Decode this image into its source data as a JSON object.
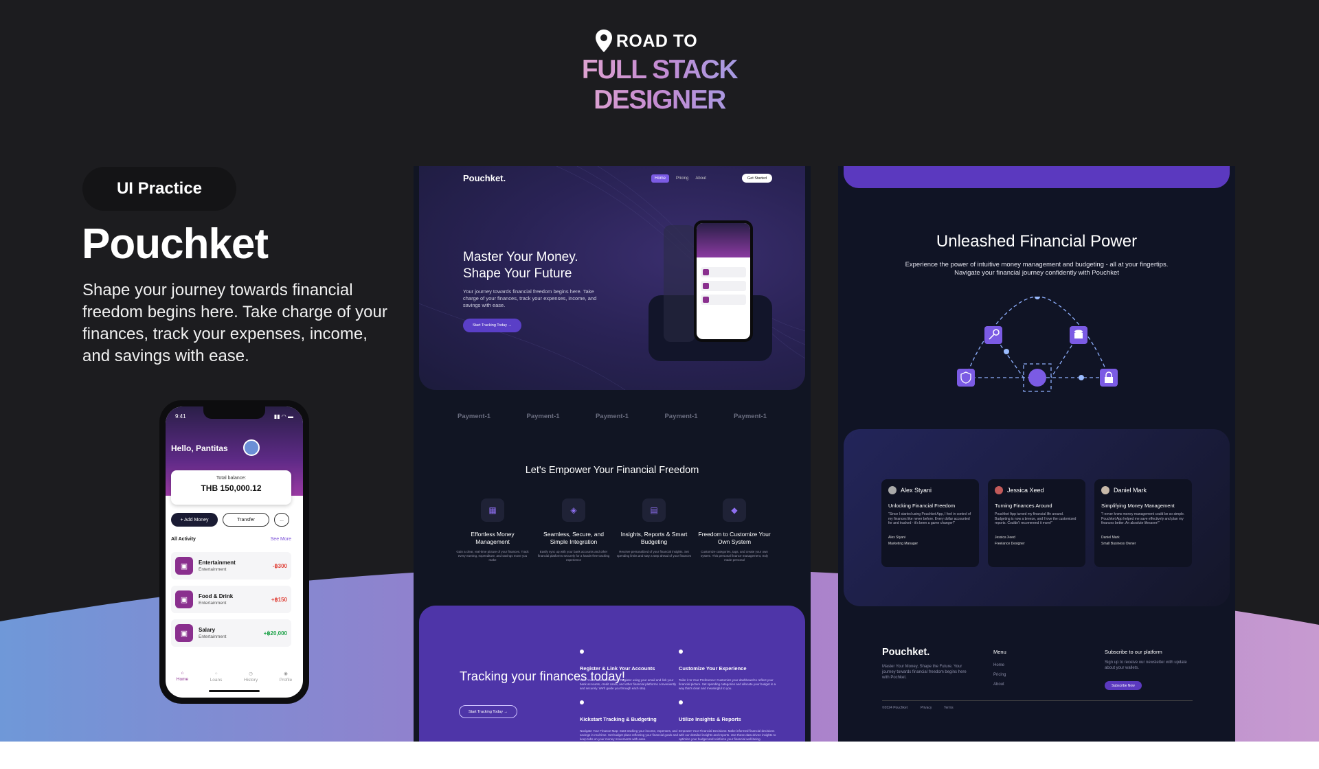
{
  "header": {
    "road_to": "ROAD TO",
    "title": "FULL STACK DESIGNER",
    "pin_icon": "location-pin-icon"
  },
  "left": {
    "pill": "UI Practice",
    "title": "Pouchket",
    "description": "Shape your  journey towards financial freedom begins here. Take charge of your finances, track your expenses, income, and savings with ease."
  },
  "phone": {
    "time": "9:41",
    "greeting": "Hello, Pantitas",
    "balance_label": "Total balance:",
    "balance_value": "THB 150,000.12",
    "add_money": "+ Add Money",
    "transfer": "Transfer",
    "more": "...",
    "activity_title": "All Activity",
    "see_more": "See More",
    "activities": [
      {
        "name": "Entertainment",
        "category": "Entertainment",
        "amount": "-฿300"
      },
      {
        "name": "Food & Drink",
        "category": "Entertainment",
        "amount": "+฿150"
      },
      {
        "name": "Salary",
        "category": "Entertainment",
        "amount": "+฿20,000"
      }
    ],
    "tabs": [
      "Home",
      "Loans",
      "History",
      "Profile"
    ]
  },
  "landing": {
    "logo": "Pouchket.",
    "nav": [
      "Home",
      "Pricing",
      "About"
    ],
    "get_started": "Get Started",
    "hero_title_1": "Master Your Money.",
    "hero_title_2": "Shape Your Future",
    "hero_text": "Your journey towards financial freedom begins here. Take charge of your finances, track your expenses, income, and savings with ease.",
    "hero_cta": "Start Tracking Today",
    "payments": [
      "Payment-1",
      "Payment-1",
      "Payment-1",
      "Payment-1",
      "Payment-1"
    ],
    "empower_title": "Let's Empower Your Financial Freedom",
    "features": [
      {
        "title": "Effortless Money Management",
        "text": "Gain a clear, real-time picture of your finances. Track every earning, expenditure, and savings move you make"
      },
      {
        "title": "Seamless, Secure, and Simple Integration",
        "text": "Easily sync up with your bank accounts and other financial platforms securely for a hands-free tracking experience"
      },
      {
        "title": "Insights, Reports & Smart Budgeting",
        "text": "Receive personalized of your financial insights. Set spending limits and stay a step ahead of your finances"
      },
      {
        "title": "Freedom to Customize Your Own System",
        "text": "Customize categories, tags, and create your own system. This personal finance management, truly made personal"
      }
    ],
    "cta_title": "Tracking your finances today!",
    "cta_button": "Start Tracking Today",
    "steps": [
      {
        "title": "Register & Link Your Accounts",
        "text": "Start Your Financial Journey: Register using your email and link your bank accounts, credit cards, and other financial platforms conveniently and securely. We'll guide you through each step."
      },
      {
        "title": "Customize Your Experience",
        "text": "Tailor it to Your Preference: Customize your dashboard to reflect your financial picture. Set spending categories and allocate your budget in a way that's clear and meaningful to you."
      },
      {
        "title": "Kickstart Tracking & Budgeting",
        "text": "Navigate Your Finance Map: Start tracking your income, expenses, and savings in real time. Set budget plans reflecting your financial goals and keep tabs on your money movements with ease."
      },
      {
        "title": "Utilize Insights & Reports",
        "text": "Empower Your Financial Decisions: Make informed financial decisions with our detailed insights and reports. Use these data-driven insights to optimize your budget and reinforce your financial well-being."
      }
    ]
  },
  "power": {
    "title": "Unleashed Financial Power",
    "text": "Experience the power of intuitive money management and budgeting - all at your fingertips. Navigate your financial journey confidently with Pouchket",
    "testimonials": [
      {
        "name": "Alex Styani",
        "title": "Unlocking Financial Freedom",
        "quote": "\"Since I started using Pouchket App, I feel in control of my finances like never before. Every dollar accounted for and tracked - it's been a game changer!\"",
        "author": "Alex Styani",
        "role": "Marketing Manager"
      },
      {
        "name": "Jessica Xeed",
        "title": "Turning Finances Around",
        "quote": "Pouchket App turned my financial life around. Budgeting is now a breeze, and I love the customized reports. Couldn't recommend it more!\"",
        "author": "Jessica Xeed",
        "role": "Freelance Designer"
      },
      {
        "name": "Daniel Mark",
        "title": "Simplifying Money Management",
        "quote": "\"I never knew money management could be so simple. Pouchket App helped me save effectively and plan my finances better. An absolute lifesaver!\"",
        "author": "Daniel Mark",
        "role": "Small Business Owner"
      }
    ],
    "footer": {
      "logo": "Pouchket.",
      "tagline": "Master Your Money, Shape the Future. Your journey towards financial freedom begins here with Pochket.",
      "menu_title": "Menu",
      "menu": [
        "Home",
        "Pricing",
        "About"
      ],
      "subscribe_title": "Subscribe to our platform",
      "subscribe_text": "Sign up to receive our newsletter with update about your wallets.",
      "subscribe_button": "Subscribe Now",
      "copyright": "©2024 Pouchket",
      "privacy": "Privacy",
      "terms": "Terms"
    }
  },
  "colors": {
    "bg": "#1c1c1f",
    "accent": "#5b39bf",
    "brand_purple": "#8a2f8e"
  }
}
